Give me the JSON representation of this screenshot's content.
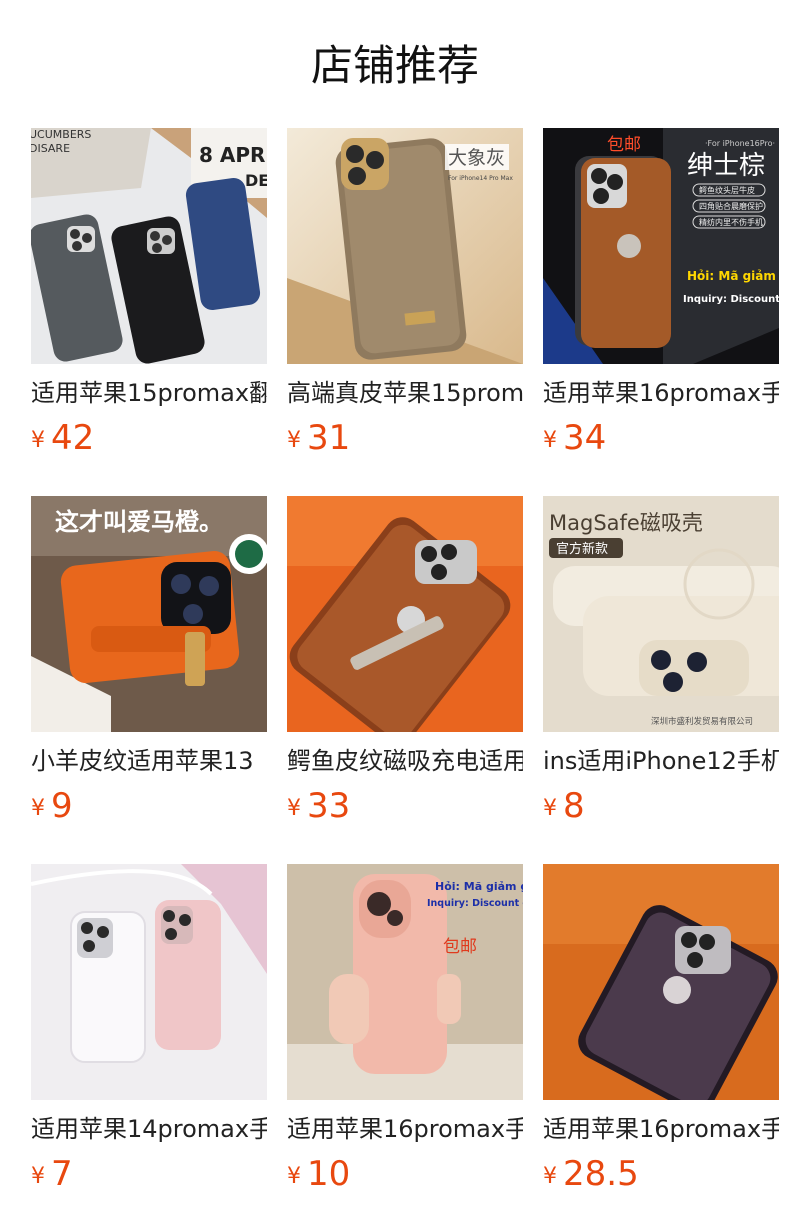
{
  "section_title": "店铺推荐",
  "accent_price_color": "#e8480f",
  "products": [
    {
      "name": "适用苹果15promax翻",
      "currency": "¥",
      "price": "42",
      "image": "three-suede-phone-cases-icon",
      "overlay_lines": [
        "UCUMBERS",
        "DISARE",
        "8 APR",
        "DE"
      ]
    },
    {
      "name": "高端真皮苹果15promax",
      "currency": "¥",
      "price": "31",
      "image": "grey-leather-phone-case-icon",
      "overlay_lines": [
        "大象灰",
        "For iPhone14 Pro Max"
      ]
    },
    {
      "name": "适用苹果16promax手",
      "currency": "¥",
      "price": "34",
      "image": "brown-croc-leather-case-icon",
      "overlay_lines": [
        "包邮",
        "·For iPhone16Pro·",
        "绅士棕",
        "鳄鱼纹头层牛皮",
        "四角贴合晨磨保护",
        "精纺内里不伤手机",
        "Hỏi: Mã giảm giá",
        "Inquiry: Discount code"
      ]
    },
    {
      "name": "小羊皮纹适用苹果13",
      "currency": "¥",
      "price": "9",
      "image": "orange-leather-case-in-hand-icon",
      "overlay_lines": [
        "这才叫爱马橙。"
      ]
    },
    {
      "name": "鳄鱼皮纹磁吸充电适用",
      "currency": "¥",
      "price": "33",
      "image": "croc-stand-case-on-orange-icon",
      "overlay_lines": []
    },
    {
      "name": "ins适用iPhone12手机",
      "currency": "¥",
      "price": "8",
      "image": "beige-magsafe-silicone-case-icon",
      "overlay_lines": [
        "MagSafe磁吸壳",
        "官方新款",
        "深圳市盛利发贸易有限公司"
      ]
    },
    {
      "name": "适用苹果14promax手",
      "currency": "¥",
      "price": "7",
      "image": "white-pink-glitter-cases-icon",
      "overlay_lines": []
    },
    {
      "name": "适用苹果16promax手",
      "currency": "¥",
      "price": "10",
      "image": "pink-case-in-hand-icon",
      "overlay_lines": [
        "Hỏi: Mã giảm giá",
        "Inquiry: Discount code",
        "包邮"
      ]
    },
    {
      "name": "适用苹果16promax手",
      "currency": "¥",
      "price": "28.5",
      "image": "purple-leather-case-on-orange-icon",
      "overlay_lines": []
    }
  ]
}
